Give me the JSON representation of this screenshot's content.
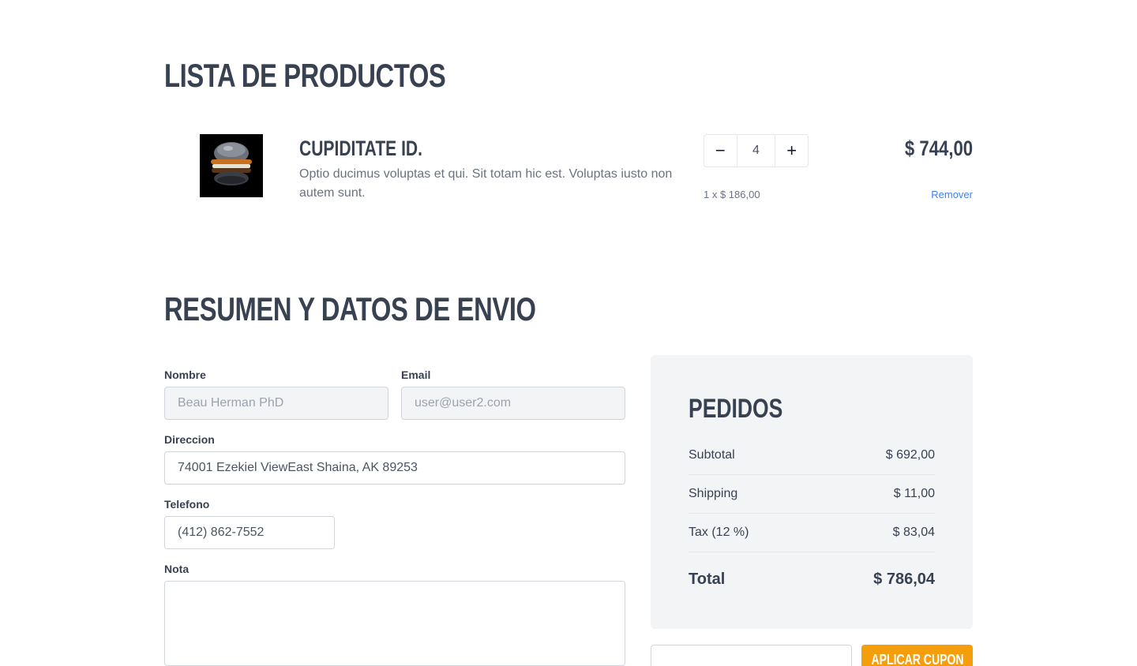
{
  "products_section": {
    "heading": "LISTA DE PRODUCTOS"
  },
  "cart_items": [
    {
      "name": "CUPIDITATE ID.",
      "description": "Optio ducimus voluptas et qui. Sit totam hic est. Voluptas iusto non autem sunt.",
      "quantity": "4",
      "unit_price_text": "1 x $ 186,00",
      "line_total": "$ 744,00",
      "remove_label": "Remover",
      "decrease_symbol": "−",
      "increase_symbol": "+",
      "image_icon": "burger-photo"
    }
  ],
  "summary_section": {
    "heading": "RESUMEN Y DATOS DE ENVIO"
  },
  "form": {
    "name_label": "Nombre",
    "name_value": "Beau Herman PhD",
    "email_label": "Email",
    "email_value": "user@user2.com",
    "address_label": "Direccion",
    "address_value": "74001 Ezekiel ViewEast Shaina, AK 89253",
    "phone_label": "Telefono",
    "phone_value": "(412) 862-7552",
    "note_label": "Nota",
    "note_value": ""
  },
  "orders": {
    "title": "PEDIDOS",
    "subtotal_label": "Subtotal",
    "subtotal_value": "$ 692,00",
    "shipping_label": "Shipping",
    "shipping_value": "$ 11,00",
    "tax_label": "Tax (12 %)",
    "tax_value": "$ 83,04",
    "total_label": "Total",
    "total_value": "$ 786,04"
  },
  "coupon": {
    "input_value": "",
    "button_label": "APLICAR CUPON"
  },
  "colors": {
    "accent": "#f59e0b",
    "link": "#3b82f6",
    "text": "#374151",
    "card_bg": "#f3f4f6"
  }
}
